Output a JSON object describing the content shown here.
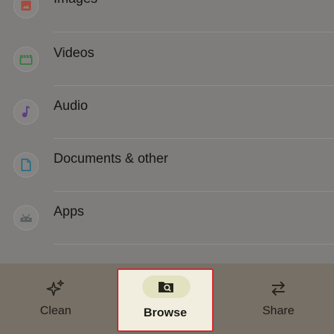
{
  "categories": [
    {
      "label": "Images",
      "icon": "image-icon",
      "color": "#a44b40"
    },
    {
      "label": "Videos",
      "icon": "video-clapper-icon",
      "color": "#3a7a45"
    },
    {
      "label": "Audio",
      "icon": "music-note-icon",
      "color": "#5b3e86"
    },
    {
      "label": "Documents & other",
      "icon": "document-icon",
      "color": "#2f6f86"
    },
    {
      "label": "Apps",
      "icon": "android-icon",
      "color": "#5a5f62"
    }
  ],
  "nav": {
    "clean_label": "Clean",
    "browse_label": "Browse",
    "share_label": "Share"
  }
}
